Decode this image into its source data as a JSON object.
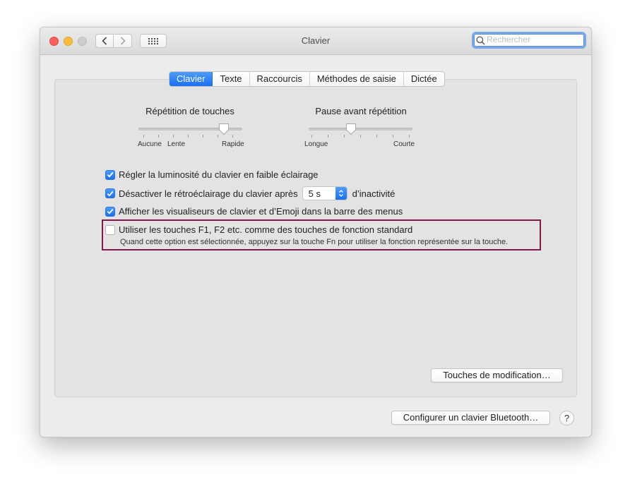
{
  "window": {
    "title": "Clavier",
    "search_placeholder": "Rechercher"
  },
  "tabs": [
    {
      "label": "Clavier",
      "active": true
    },
    {
      "label": "Texte",
      "active": false
    },
    {
      "label": "Raccourcis",
      "active": false
    },
    {
      "label": "Méthodes de saisie",
      "active": false
    },
    {
      "label": "Dictée",
      "active": false
    }
  ],
  "key_repeat": {
    "label": "Répétition de touches",
    "tick_labels": [
      "Aucune",
      "Lente",
      "Rapide"
    ],
    "level": 0.83
  },
  "delay_until_repeat": {
    "label": "Pause avant répétition",
    "tick_labels": [
      "Longue",
      "Courte"
    ],
    "level": 0.4
  },
  "options": {
    "brightness": {
      "label": "Régler la luminosité du clavier en faible éclairage",
      "checked": true
    },
    "backlight": {
      "label_before": "Désactiver le rétroéclairage du clavier après",
      "value": "5 s",
      "label_after": "d’inactivité",
      "checked": true
    },
    "viewers": {
      "label": "Afficher les visualiseurs de clavier et d’Emoji dans la barre des menus",
      "checked": true
    },
    "fn_keys": {
      "label": "Utiliser les touches F1, F2 etc. comme des touches de fonction standard",
      "note": "Quand cette option est sélectionnée, appuyez sur la touche Fn pour utiliser la fonction représentée sur la touche.",
      "checked": false
    }
  },
  "buttons": {
    "modifier_keys": "Touches de modification…",
    "bluetooth": "Configurer un clavier Bluetooth…",
    "help": "?"
  },
  "colors": {
    "accent": "#1a70ee",
    "highlight_border": "#80194a"
  }
}
